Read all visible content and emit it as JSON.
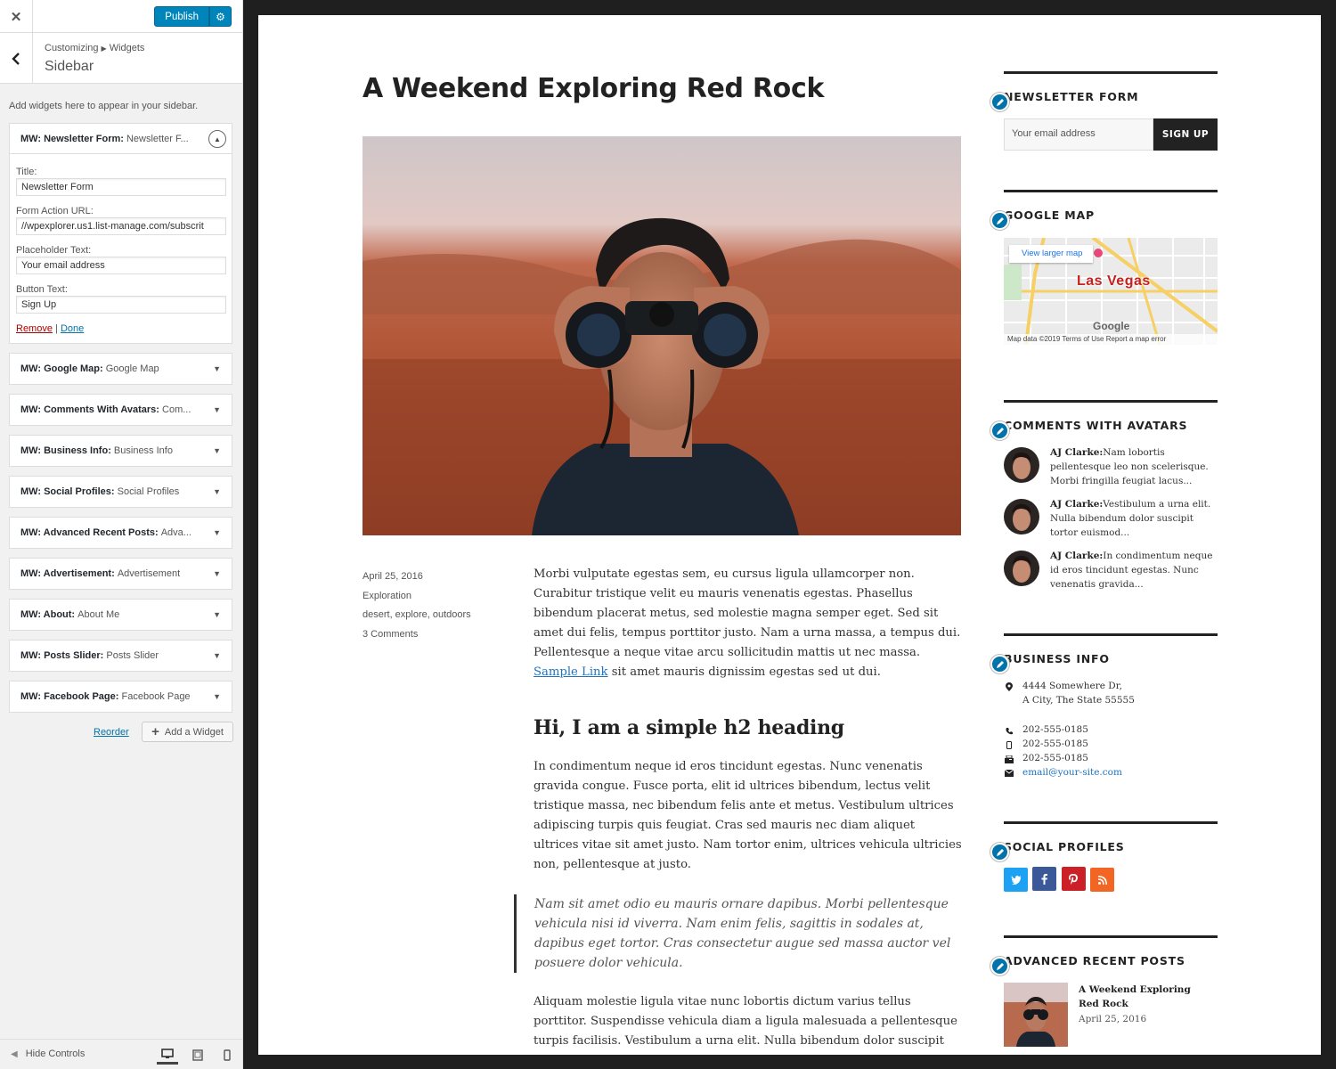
{
  "customizer": {
    "close_icon": "close-icon",
    "publish_label": "Publish",
    "crumb_root": "Customizing",
    "crumb_current": "Widgets",
    "section_title": "Sidebar",
    "description": "Add widgets here to appear in your sidebar.",
    "open_widget": {
      "type": "MW: Newsletter Form:",
      "title": "Newsletter F...",
      "fields": [
        {
          "label": "Title:",
          "value": "Newsletter Form"
        },
        {
          "label": "Form Action URL:",
          "value": "//wpexplorer.us1.list-manage.com/subscrit"
        },
        {
          "label": "Placeholder Text:",
          "value": "Your email address"
        },
        {
          "label": "Button Text:",
          "value": "Sign Up"
        }
      ],
      "remove_label": "Remove",
      "separator": "|",
      "done_label": "Done"
    },
    "widgets": [
      {
        "type": "MW: Google Map:",
        "title": "Google Map"
      },
      {
        "type": "MW: Comments With Avatars:",
        "title": "Com..."
      },
      {
        "type": "MW: Business Info:",
        "title": "Business Info"
      },
      {
        "type": "MW: Social Profiles:",
        "title": "Social Profiles"
      },
      {
        "type": "MW: Advanced Recent Posts:",
        "title": "Adva..."
      },
      {
        "type": "MW: Advertisement:",
        "title": "Advertisement"
      },
      {
        "type": "MW: About:",
        "title": "About Me"
      },
      {
        "type": "MW: Posts Slider:",
        "title": "Posts Slider"
      },
      {
        "type": "MW: Facebook Page:",
        "title": "Facebook Page"
      }
    ],
    "reorder_label": "Reorder",
    "add_widget_label": "Add a Widget",
    "hide_controls_label": "Hide Controls",
    "active_device": "desktop"
  },
  "post": {
    "title": "A Weekend Exploring Red Rock",
    "date": "April 25, 2016",
    "category": "Exploration",
    "tags": "desert, explore, outdoors",
    "comments": "3 Comments",
    "p1_before": "Morbi vulputate egestas sem, eu cursus ligula ullamcorper non. Curabitur tristique velit eu mauris venenatis egestas. Phasellus bibendum placerat metus, sed molestie magna semper eget. Sed sit amet dui felis, tempus porttitor justo. Nam a urna massa, a tempus dui. Pellentesque a neque vitae arcu sollicitudin mattis ut nec massa.",
    "p1_link": "Sample Link",
    "p1_after": "sit amet mauris dignissim egestas sed ut dui.",
    "h2": "Hi, I am a simple h2 heading",
    "p2": "In condimentum neque id eros tincidunt egestas. Nunc venenatis gravida congue. Fusce porta, elit id ultrices bibendum, lectus velit tristique massa, nec bibendum felis ante et metus. Vestibulum ultrices adipiscing turpis quis feugiat. Cras sed mauris nec diam aliquet ultrices vitae sit amet justo. Nam tortor enim, ultrices vehicula ultricies non, pellentesque at justo.",
    "quote": "Nam sit amet odio eu mauris ornare dapibus. Morbi pellentesque vehicula nisi id viverra. Nam enim felis, sagittis in sodales at, dapibus eget tortor. Cras consectetur augue sed massa auctor vel posuere dolor vehicula.",
    "p3": "Aliquam molestie ligula vitae nunc lobortis dictum varius tellus porttitor. Suspendisse vehicula diam a ligula malesuada a pellentesque turpis facilisis. Vestibulum a urna elit. Nulla bibendum dolor suscipit tortor euismod eu laoreet odio facilisis. Praesent rhoncus metus non tortor"
  },
  "sidebar": {
    "newsletter": {
      "title": "NEWSLETTER FORM",
      "placeholder": "Your email address",
      "button": "SIGN UP"
    },
    "map": {
      "title": "GOOGLE MAP",
      "link": "View larger map",
      "city": "Las Vegas",
      "footer": "Map data ©2019   Terms of Use   Report a map error",
      "brand": "Google"
    },
    "comments": {
      "title": "COMMENTS WITH AVATARS",
      "items": [
        {
          "author": "AJ Clarke:",
          "text": "Nam lobortis pellentesque leo non scelerisque. Morbi fringilla feugiat lacus..."
        },
        {
          "author": "AJ Clarke:",
          "text": "Vestibulum a urna elit. Nulla bibendum dolor suscipit tortor euismod..."
        },
        {
          "author": "AJ Clarke:",
          "text": "In condimentum neque id eros tincidunt egestas. Nunc venenatis gravida..."
        }
      ]
    },
    "business": {
      "title": "BUSINESS INFO",
      "address1": "4444 Somewhere Dr,",
      "address2": "A City, The State 55555",
      "phone": "202-555-0185",
      "mobile": "202-555-0185",
      "fax": "202-555-0185",
      "email": "email@your-site.com"
    },
    "social": {
      "title": "SOCIAL PROFILES",
      "icons": [
        "twitter-icon",
        "facebook-icon",
        "pinterest-icon",
        "rss-icon"
      ],
      "colors": [
        "#1da1f2",
        "#3b5998",
        "#cb2027",
        "#f26522"
      ]
    },
    "recent": {
      "title": "ADVANCED RECENT POSTS",
      "post_title": "A Weekend Exploring Red Rock",
      "post_date": "April 25, 2016"
    }
  }
}
